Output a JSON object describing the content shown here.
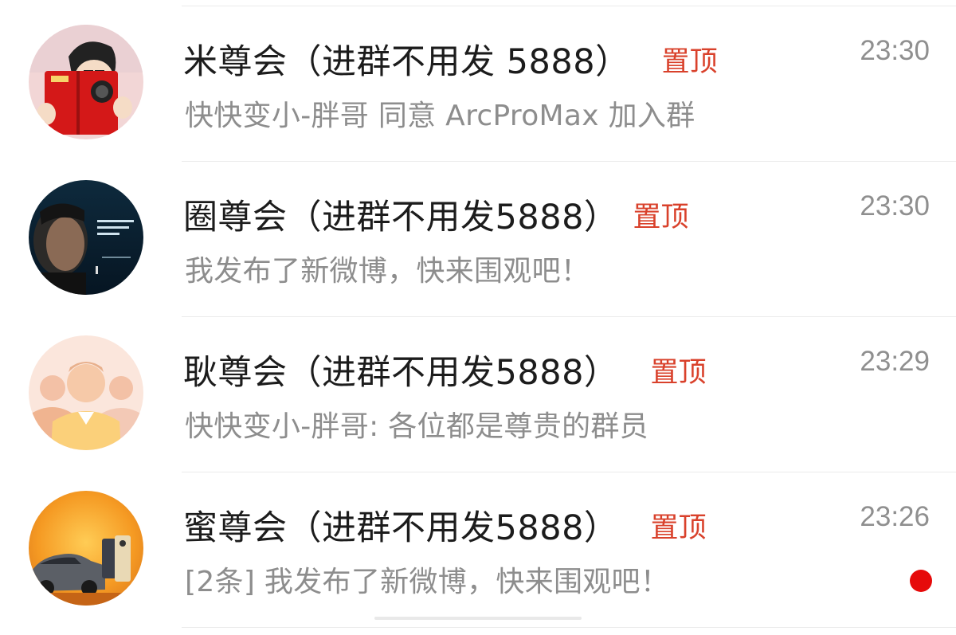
{
  "chats": [
    {
      "name": "米尊会（进群不用发 5888）",
      "pin_label": "置顶",
      "preview": "快快变小-胖哥 同意 ArcProMax 加入群",
      "time": "23:30",
      "avatar_icon": "cartoon-man-holding-red-phone-icon",
      "unread": false
    },
    {
      "name": "圈尊会（进群不用发5888）",
      "pin_label": "置顶",
      "preview": "我发布了新微博，快来围观吧！",
      "time": "23:30",
      "avatar_icon": "man-speaking-on-stage-icon",
      "unread": false
    },
    {
      "name": "耿尊会（进群不用发5888）",
      "pin_label": "置顶",
      "preview": "快快变小-胖哥: 各位都是尊贵的群员",
      "time": "23:29",
      "avatar_icon": "group-people-icon",
      "unread": false
    },
    {
      "name": "蜜尊会（进群不用发5888）",
      "pin_label": "置顶",
      "preview": "[2条] 我发布了新微博，快来围观吧！",
      "time": "23:26",
      "avatar_icon": "car-and-phone-ad-icon",
      "unread": true
    }
  ],
  "colors": {
    "pin": "#d9412b",
    "unread_dot": "#e60a0a",
    "title": "#1c1c1c",
    "secondary": "#8d8d8d"
  }
}
